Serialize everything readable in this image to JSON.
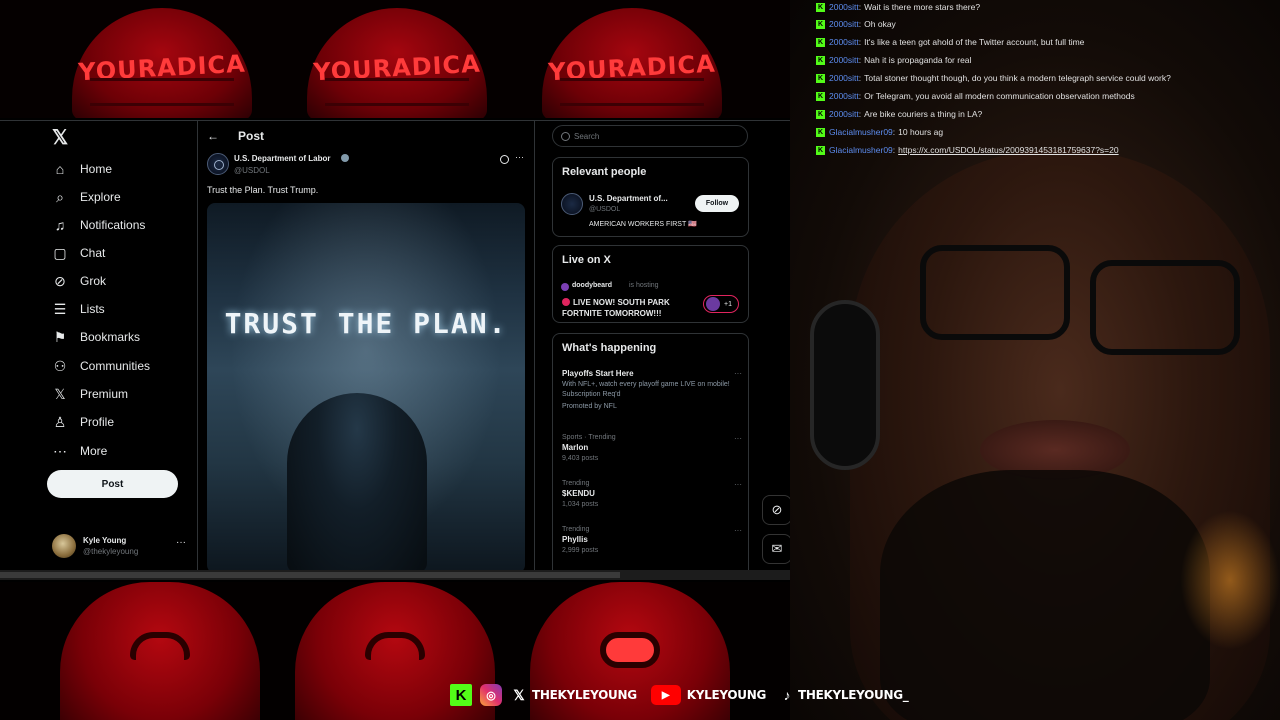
{
  "colors": {
    "x_background": "#000000",
    "x_text": "#e7e9ea",
    "x_muted": "#71767b",
    "x_border": "#2f3336",
    "chat_username": "#5d8df0",
    "kick_green": "#53fc18",
    "live_red": "#e0245e"
  },
  "stream_overlay": {
    "hat_text": "YOURADICA"
  },
  "nav": {
    "logo": "𝕏",
    "items": [
      {
        "label": "Home",
        "icon": "home-icon",
        "glyph": "⌂"
      },
      {
        "label": "Explore",
        "icon": "search-icon",
        "glyph": "⌕"
      },
      {
        "label": "Notifications",
        "icon": "bell-icon",
        "glyph": "♫"
      },
      {
        "label": "Chat",
        "icon": "chat-icon",
        "glyph": "▢"
      },
      {
        "label": "Grok",
        "icon": "grok-icon",
        "glyph": "⊘"
      },
      {
        "label": "Lists",
        "icon": "lists-icon",
        "glyph": "☰"
      },
      {
        "label": "Bookmarks",
        "icon": "bookmark-icon",
        "glyph": "⚑"
      },
      {
        "label": "Communities",
        "icon": "communities-icon",
        "glyph": "⚇"
      },
      {
        "label": "Premium",
        "icon": "x-premium-icon",
        "glyph": "𝕏"
      },
      {
        "label": "Profile",
        "icon": "profile-icon",
        "glyph": "♙"
      },
      {
        "label": "More",
        "icon": "more-circle-icon",
        "glyph": "⋯"
      }
    ],
    "post_button": "Post",
    "account": {
      "name": "Kyle Young",
      "handle": "@thekyleyoung",
      "more": "···"
    }
  },
  "post_view": {
    "header_title": "Post",
    "back_glyph": "←",
    "author": "U.S. Department of Labor",
    "handle": "@USDOL",
    "more": "···",
    "text": "Trust the Plan. Trust Trump.",
    "media_caption": "TRUST THE PLAN."
  },
  "sidebar": {
    "search_placeholder": "Search",
    "relevant": {
      "title": "Relevant people",
      "name": "U.S. Department of...",
      "handle": "@USDOL",
      "bio": "AMERICAN WORKERS FIRST 🇺🇸",
      "follow": "Follow"
    },
    "live": {
      "title": "Live on X",
      "host": "doodybeard",
      "status": "is hosting",
      "stream_title": "LIVE NOW! SOUTH PARK FORTNITE TOMORROW!!!",
      "listeners": "+1"
    },
    "happening": {
      "title": "What's happening",
      "trends": [
        {
          "meta": "",
          "title": "Playoffs Start Here",
          "desc": "With NFL+, watch every playoff game LIVE on mobile! Subscription Req'd",
          "extra": "Promoted by NFL"
        },
        {
          "meta": "Sports · Trending",
          "title": "Marlon",
          "desc": "9,403 posts",
          "extra": ""
        },
        {
          "meta": "Trending",
          "title": "$KENDU",
          "desc": "1,034 posts",
          "extra": ""
        },
        {
          "meta": "Trending",
          "title": "Phyllis",
          "desc": "2,999 posts",
          "extra": ""
        }
      ]
    }
  },
  "floating_buttons": {
    "grok_glyph": "⊘",
    "messages_glyph": "✉"
  },
  "chat": {
    "messages": [
      {
        "user": "2000sitt",
        "text": "Wait is there more stars there?"
      },
      {
        "user": "2000sitt",
        "text": "Oh okay"
      },
      {
        "user": "2000sitt",
        "text": "It's like a teen got ahold of the Twitter account, but full time"
      },
      {
        "user": "2000sitt",
        "text": "Nah it is propaganda for real"
      },
      {
        "user": "2000sitt",
        "text": "Total stoner thought though, do you think a modern telegraph service could work?"
      },
      {
        "user": "2000sitt",
        "text": "Or Telegram, you avoid all modern communication observation methods"
      },
      {
        "user": "2000sitt",
        "text": "Are bike couriers a thing in LA?"
      },
      {
        "user": "Glacialmusher09",
        "text": "10 hours ag"
      },
      {
        "user": "Glacialmusher09",
        "text": "https://x.com/USDOL/status/2009391453181759637?s=20",
        "is_link": true
      }
    ]
  },
  "socials": {
    "kick_glyph": "K",
    "instagram_glyph": "◎",
    "x_glyph": "𝕏",
    "x_handle": "THEKYLEYOUNG",
    "youtube_glyph": "▶",
    "youtube_handle": "KYLEYOUNG",
    "tiktok_glyph": "♪",
    "tiktok_handle": "THEKYLEYOUNG_"
  }
}
